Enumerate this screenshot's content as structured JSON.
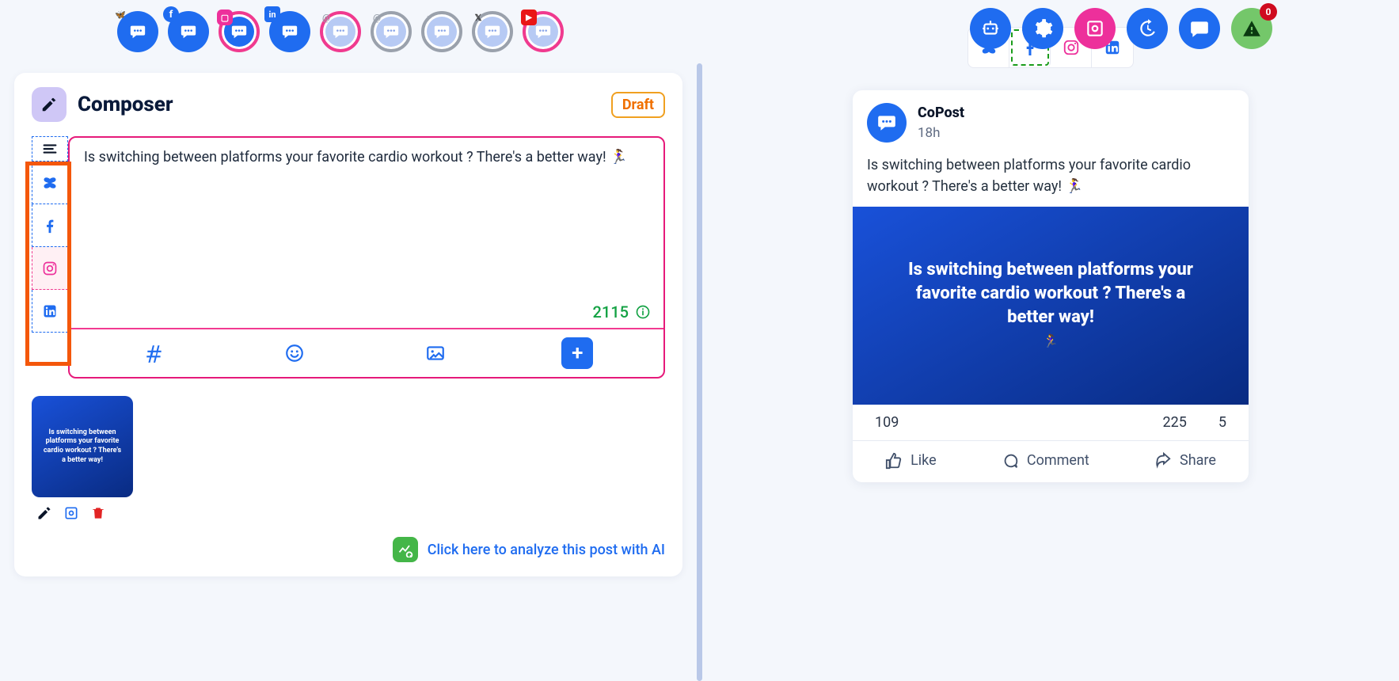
{
  "composer": {
    "title": "Composer",
    "draft_label": "Draft",
    "text": "Is switching between platforms your favorite cardio workout ? There's a better way! 🏃‍♀️",
    "char_count": "2115",
    "ai_link": "Click here to analyze this post with AI",
    "thumb_text": "Is switching between platforms your favorite cardio workout ? There's a better way!"
  },
  "top_chips": {
    "badges": [
      "🦋",
      "f",
      "📷",
      "in",
      "@",
      "@",
      "♪",
      "X",
      "▶"
    ]
  },
  "right_top": {
    "notif_count": "0"
  },
  "preview": {
    "author": "CoPost",
    "time": "18h",
    "body": "Is switching between platforms your favorite cardio workout ? There's a better way! 🏃‍♀️",
    "image_text": "Is switching between platforms your favorite cardio workout ? There's a better way!",
    "stats": {
      "likes": "109",
      "comments": "225",
      "shares": "5"
    },
    "actions": {
      "like": "Like",
      "comment": "Comment",
      "share": "Share"
    }
  }
}
